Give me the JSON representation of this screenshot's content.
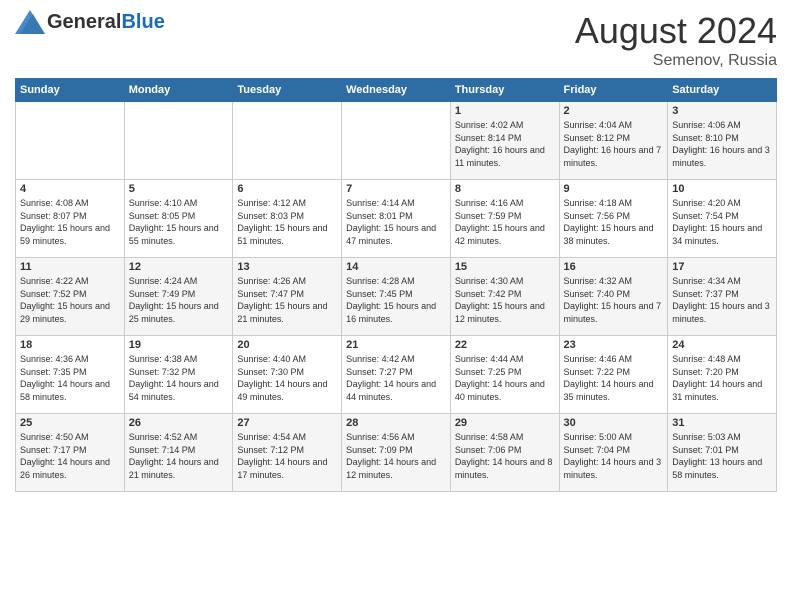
{
  "logo": {
    "general": "General",
    "blue": "Blue"
  },
  "title": {
    "month_year": "August 2024",
    "location": "Semenov, Russia"
  },
  "days_header": [
    "Sunday",
    "Monday",
    "Tuesday",
    "Wednesday",
    "Thursday",
    "Friday",
    "Saturday"
  ],
  "weeks": [
    [
      {
        "day": "",
        "info": ""
      },
      {
        "day": "",
        "info": ""
      },
      {
        "day": "",
        "info": ""
      },
      {
        "day": "",
        "info": ""
      },
      {
        "day": "1",
        "info": "Sunrise: 4:02 AM\nSunset: 8:14 PM\nDaylight: 16 hours\nand 11 minutes."
      },
      {
        "day": "2",
        "info": "Sunrise: 4:04 AM\nSunset: 8:12 PM\nDaylight: 16 hours\nand 7 minutes."
      },
      {
        "day": "3",
        "info": "Sunrise: 4:06 AM\nSunset: 8:10 PM\nDaylight: 16 hours\nand 3 minutes."
      }
    ],
    [
      {
        "day": "4",
        "info": "Sunrise: 4:08 AM\nSunset: 8:07 PM\nDaylight: 15 hours\nand 59 minutes."
      },
      {
        "day": "5",
        "info": "Sunrise: 4:10 AM\nSunset: 8:05 PM\nDaylight: 15 hours\nand 55 minutes."
      },
      {
        "day": "6",
        "info": "Sunrise: 4:12 AM\nSunset: 8:03 PM\nDaylight: 15 hours\nand 51 minutes."
      },
      {
        "day": "7",
        "info": "Sunrise: 4:14 AM\nSunset: 8:01 PM\nDaylight: 15 hours\nand 47 minutes."
      },
      {
        "day": "8",
        "info": "Sunrise: 4:16 AM\nSunset: 7:59 PM\nDaylight: 15 hours\nand 42 minutes."
      },
      {
        "day": "9",
        "info": "Sunrise: 4:18 AM\nSunset: 7:56 PM\nDaylight: 15 hours\nand 38 minutes."
      },
      {
        "day": "10",
        "info": "Sunrise: 4:20 AM\nSunset: 7:54 PM\nDaylight: 15 hours\nand 34 minutes."
      }
    ],
    [
      {
        "day": "11",
        "info": "Sunrise: 4:22 AM\nSunset: 7:52 PM\nDaylight: 15 hours\nand 29 minutes."
      },
      {
        "day": "12",
        "info": "Sunrise: 4:24 AM\nSunset: 7:49 PM\nDaylight: 15 hours\nand 25 minutes."
      },
      {
        "day": "13",
        "info": "Sunrise: 4:26 AM\nSunset: 7:47 PM\nDaylight: 15 hours\nand 21 minutes."
      },
      {
        "day": "14",
        "info": "Sunrise: 4:28 AM\nSunset: 7:45 PM\nDaylight: 15 hours\nand 16 minutes."
      },
      {
        "day": "15",
        "info": "Sunrise: 4:30 AM\nSunset: 7:42 PM\nDaylight: 15 hours\nand 12 minutes."
      },
      {
        "day": "16",
        "info": "Sunrise: 4:32 AM\nSunset: 7:40 PM\nDaylight: 15 hours\nand 7 minutes."
      },
      {
        "day": "17",
        "info": "Sunrise: 4:34 AM\nSunset: 7:37 PM\nDaylight: 15 hours\nand 3 minutes."
      }
    ],
    [
      {
        "day": "18",
        "info": "Sunrise: 4:36 AM\nSunset: 7:35 PM\nDaylight: 14 hours\nand 58 minutes."
      },
      {
        "day": "19",
        "info": "Sunrise: 4:38 AM\nSunset: 7:32 PM\nDaylight: 14 hours\nand 54 minutes."
      },
      {
        "day": "20",
        "info": "Sunrise: 4:40 AM\nSunset: 7:30 PM\nDaylight: 14 hours\nand 49 minutes."
      },
      {
        "day": "21",
        "info": "Sunrise: 4:42 AM\nSunset: 7:27 PM\nDaylight: 14 hours\nand 44 minutes."
      },
      {
        "day": "22",
        "info": "Sunrise: 4:44 AM\nSunset: 7:25 PM\nDaylight: 14 hours\nand 40 minutes."
      },
      {
        "day": "23",
        "info": "Sunrise: 4:46 AM\nSunset: 7:22 PM\nDaylight: 14 hours\nand 35 minutes."
      },
      {
        "day": "24",
        "info": "Sunrise: 4:48 AM\nSunset: 7:20 PM\nDaylight: 14 hours\nand 31 minutes."
      }
    ],
    [
      {
        "day": "25",
        "info": "Sunrise: 4:50 AM\nSunset: 7:17 PM\nDaylight: 14 hours\nand 26 minutes."
      },
      {
        "day": "26",
        "info": "Sunrise: 4:52 AM\nSunset: 7:14 PM\nDaylight: 14 hours\nand 21 minutes."
      },
      {
        "day": "27",
        "info": "Sunrise: 4:54 AM\nSunset: 7:12 PM\nDaylight: 14 hours\nand 17 minutes."
      },
      {
        "day": "28",
        "info": "Sunrise: 4:56 AM\nSunset: 7:09 PM\nDaylight: 14 hours\nand 12 minutes."
      },
      {
        "day": "29",
        "info": "Sunrise: 4:58 AM\nSunset: 7:06 PM\nDaylight: 14 hours\nand 8 minutes."
      },
      {
        "day": "30",
        "info": "Sunrise: 5:00 AM\nSunset: 7:04 PM\nDaylight: 14 hours\nand 3 minutes."
      },
      {
        "day": "31",
        "info": "Sunrise: 5:03 AM\nSunset: 7:01 PM\nDaylight: 13 hours\nand 58 minutes."
      }
    ]
  ]
}
